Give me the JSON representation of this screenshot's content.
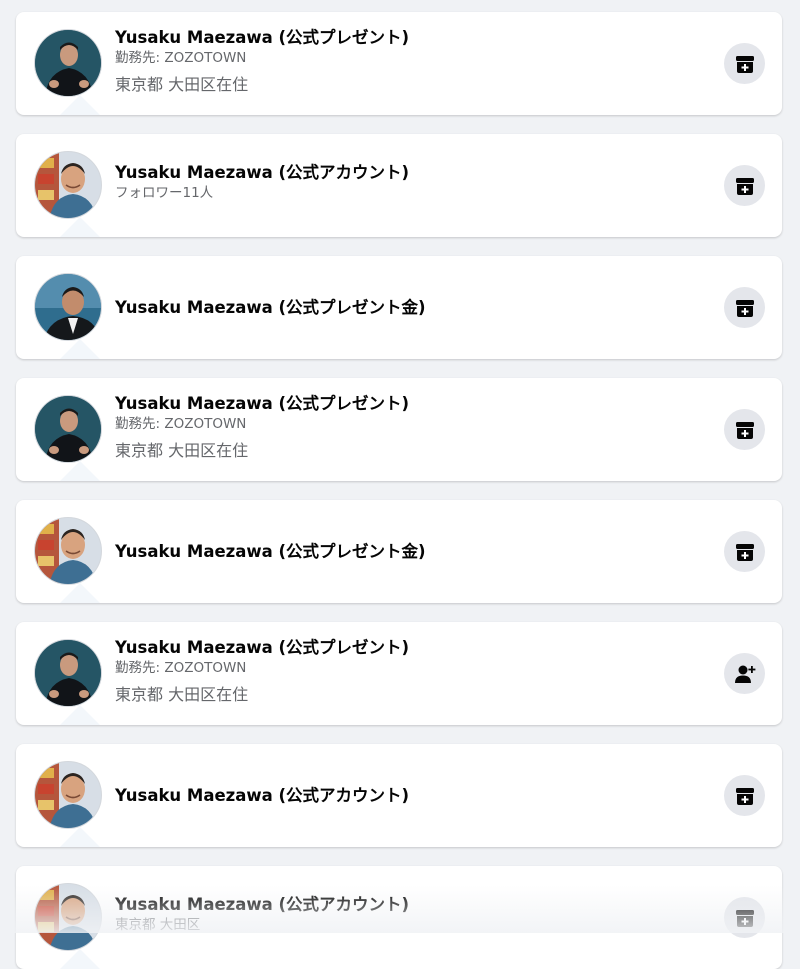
{
  "colors": {
    "page_background": "#f0f2f5",
    "card_background": "#ffffff",
    "name_text": "#050505",
    "secondary_text": "#65676b",
    "action_button_background": "#e4e6eb"
  },
  "results": [
    {
      "name": "Yusaku Maezawa (公式プレゼント)",
      "subtitle": "勤務先: ZOZOTOWN",
      "location": "東京都 大田区在住",
      "avatar": "avatar-black-shirt",
      "action_icon": "add-to-box-icon"
    },
    {
      "name": "Yusaku Maezawa (公式アカウント)",
      "subtitle": "フォロワー11人",
      "location": "",
      "avatar": "avatar-blue-shirt",
      "action_icon": "add-to-box-icon"
    },
    {
      "name": "Yusaku Maezawa (公式プレゼント金)",
      "subtitle": "",
      "location": "",
      "avatar": "avatar-suit",
      "action_icon": "add-to-box-icon"
    },
    {
      "name": "Yusaku Maezawa (公式プレゼント)",
      "subtitle": "勤務先: ZOZOTOWN",
      "location": "東京都 大田区在住",
      "avatar": "avatar-black-shirt",
      "action_icon": "add-to-box-icon"
    },
    {
      "name": "Yusaku Maezawa (公式プレゼント金)",
      "subtitle": "",
      "location": "",
      "avatar": "avatar-blue-shirt",
      "action_icon": "add-to-box-icon"
    },
    {
      "name": "Yusaku Maezawa (公式プレゼント)",
      "subtitle": "勤務先: ZOZOTOWN",
      "location": "東京都 大田区在住",
      "avatar": "avatar-black-shirt",
      "action_icon": "add-friend-icon"
    },
    {
      "name": "Yusaku Maezawa (公式アカウント)",
      "subtitle": "",
      "location": "",
      "avatar": "avatar-blue-shirt",
      "action_icon": "add-to-box-icon"
    },
    {
      "name": "Yusaku Maezawa (公式アカウント)",
      "subtitle": "東京都 大田区",
      "location": "",
      "avatar": "avatar-blue-shirt",
      "action_icon": "add-to-box-icon"
    }
  ]
}
